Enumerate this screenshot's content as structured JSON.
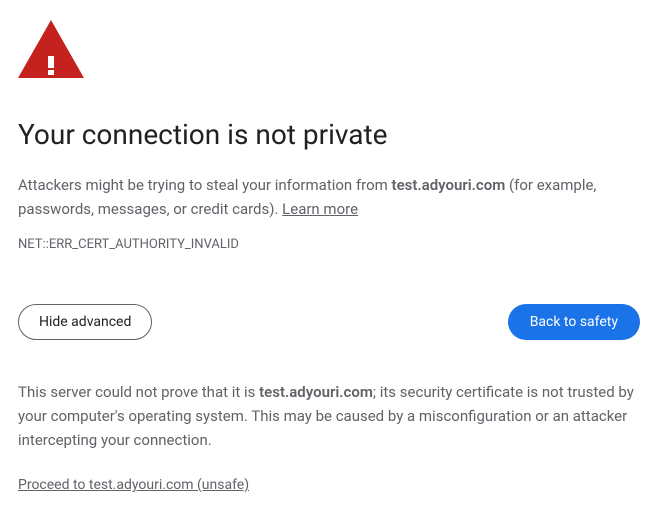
{
  "title": "Your connection is not private",
  "warning": {
    "prefix": "Attackers might be trying to steal your information from ",
    "domain": "test.adyouri.com",
    "suffix": " (for example, passwords, messages, or credit cards). ",
    "learn_more": "Learn more"
  },
  "error_code": "NET::ERR_CERT_AUTHORITY_INVALID",
  "buttons": {
    "advanced": "Hide advanced",
    "back": "Back to safety"
  },
  "advanced": {
    "prefix": "This server could not prove that it is ",
    "domain": "test.adyouri.com",
    "suffix": "; its security certificate is not trusted by your computer's operating system. This may be caused by a misconfiguration or an attacker intercepting your connection."
  },
  "proceed_link": "Proceed to test.adyouri.com (unsafe)"
}
